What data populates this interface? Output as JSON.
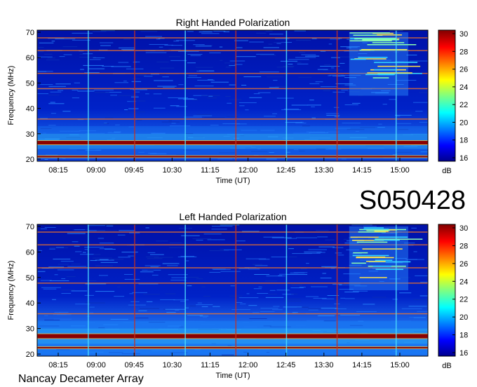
{
  "footer": "Nancay Decameter Array",
  "observation_id": "S050428",
  "colors": {
    "background": "#00007f",
    "band_hot": "#8b0000"
  },
  "chart_data": [
    {
      "type": "heatmap",
      "title": "Right Handed Polarization",
      "xlabel": "Time (UT)",
      "ylabel": "Frequency (MHz)",
      "x_ticks": [
        "08:15",
        "09:00",
        "09:45",
        "10:30",
        "11:15",
        "12:00",
        "12:45",
        "13:30",
        "14:15",
        "15:00"
      ],
      "y_ticks": [
        "20",
        "30",
        "40",
        "50",
        "60",
        "70"
      ],
      "ylim": [
        20,
        70
      ],
      "colorbar": {
        "unit": "dB",
        "ticks": [
          "16",
          "18",
          "20",
          "22",
          "24",
          "26",
          "28",
          "30"
        ],
        "range": [
          16,
          30
        ]
      },
      "features": {
        "persistent_bands_mhz": [
          26.5,
          21.0
        ],
        "interference_lines_mhz": [
          68.0,
          63.0,
          54.0,
          48.0,
          36.0
        ],
        "vertical_markers_ut": [
          "08:50",
          "09:45",
          "10:45",
          "11:45",
          "12:45",
          "13:45",
          "14:55"
        ],
        "burst_region": {
          "time_ut": [
            "14:00",
            "15:10"
          ],
          "freq_mhz": [
            45,
            70
          ]
        }
      }
    },
    {
      "type": "heatmap",
      "title": "Left Handed Polarization",
      "xlabel": "Time (UT)",
      "ylabel": "Frequency (MHz)",
      "x_ticks": [
        "08:15",
        "09:00",
        "09:45",
        "10:30",
        "11:15",
        "12:00",
        "12:45",
        "13:30",
        "14:15",
        "15:00"
      ],
      "y_ticks": [
        "20",
        "30",
        "40",
        "50",
        "60",
        "70"
      ],
      "ylim": [
        20,
        70
      ],
      "colorbar": {
        "unit": "dB",
        "ticks": [
          "16",
          "18",
          "20",
          "22",
          "24",
          "26",
          "28",
          "30"
        ],
        "range": [
          16,
          30
        ]
      },
      "features": {
        "persistent_bands_mhz": [
          27.0,
          22.5
        ],
        "interference_lines_mhz": [
          68.0,
          63.0,
          54.0,
          48.0,
          36.0
        ],
        "vertical_markers_ut": [
          "08:50",
          "09:45",
          "10:45",
          "11:45",
          "12:45",
          "13:45",
          "14:55"
        ],
        "burst_region": {
          "time_ut": [
            "14:00",
            "15:10"
          ],
          "freq_mhz": [
            45,
            70
          ]
        }
      }
    }
  ]
}
